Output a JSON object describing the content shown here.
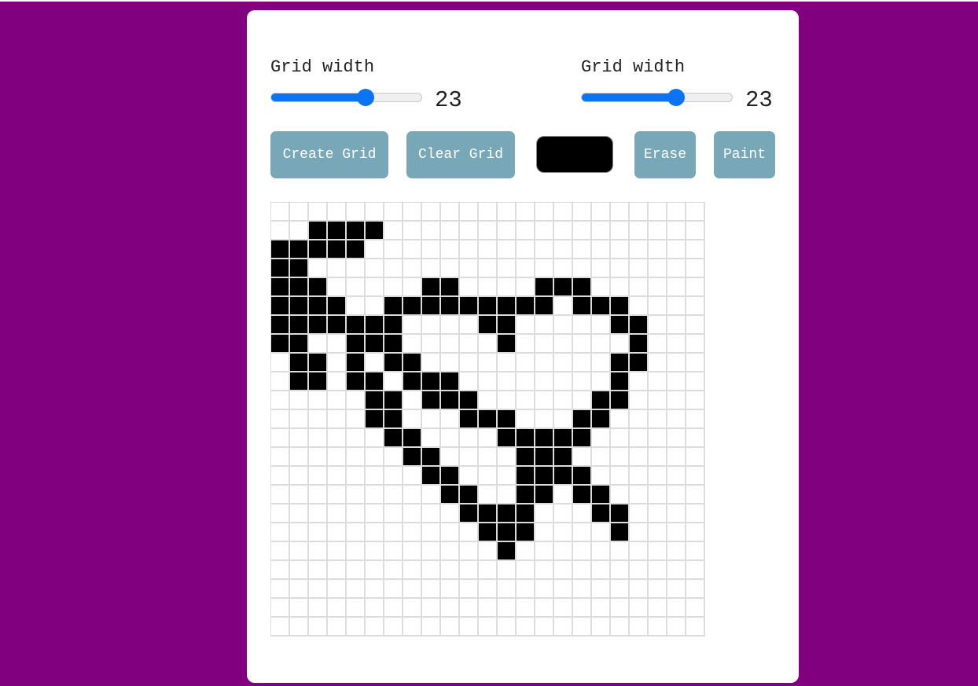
{
  "controls": {
    "width_slider": {
      "label": "Grid width",
      "value": 23,
      "min": 1,
      "max": 35
    },
    "height_slider": {
      "label": "Grid width",
      "value": 23,
      "min": 1,
      "max": 35
    }
  },
  "buttons": {
    "create": "Create Grid",
    "clear": "Clear Grid",
    "erase": "Erase",
    "paint": "Paint"
  },
  "colors": {
    "background": "#800080",
    "card": "#ffffff",
    "button": "#78a8b8",
    "slider_accent": "#0a74f5",
    "selected_paint": "#000000",
    "grid_line": "#dcdcdc"
  },
  "grid": {
    "columns": 23,
    "rows": 23,
    "filled_cells": [
      [
        1,
        2
      ],
      [
        1,
        3
      ],
      [
        1,
        4
      ],
      [
        1,
        5
      ],
      [
        2,
        0
      ],
      [
        2,
        1
      ],
      [
        2,
        2
      ],
      [
        2,
        3
      ],
      [
        2,
        4
      ],
      [
        3,
        0
      ],
      [
        3,
        1
      ],
      [
        4,
        0
      ],
      [
        4,
        1
      ],
      [
        4,
        2
      ],
      [
        4,
        8
      ],
      [
        4,
        9
      ],
      [
        4,
        14
      ],
      [
        4,
        15
      ],
      [
        4,
        16
      ],
      [
        5,
        0
      ],
      [
        5,
        1
      ],
      [
        5,
        2
      ],
      [
        5,
        3
      ],
      [
        5,
        6
      ],
      [
        5,
        7
      ],
      [
        5,
        8
      ],
      [
        5,
        9
      ],
      [
        5,
        10
      ],
      [
        5,
        11
      ],
      [
        5,
        12
      ],
      [
        5,
        13
      ],
      [
        5,
        14
      ],
      [
        5,
        16
      ],
      [
        5,
        17
      ],
      [
        5,
        18
      ],
      [
        6,
        0
      ],
      [
        6,
        1
      ],
      [
        6,
        2
      ],
      [
        6,
        3
      ],
      [
        6,
        4
      ],
      [
        6,
        5
      ],
      [
        6,
        6
      ],
      [
        6,
        11
      ],
      [
        6,
        12
      ],
      [
        6,
        18
      ],
      [
        6,
        19
      ],
      [
        7,
        0
      ],
      [
        7,
        1
      ],
      [
        7,
        4
      ],
      [
        7,
        5
      ],
      [
        7,
        6
      ],
      [
        7,
        12
      ],
      [
        7,
        19
      ],
      [
        8,
        1
      ],
      [
        8,
        2
      ],
      [
        8,
        4
      ],
      [
        8,
        6
      ],
      [
        8,
        7
      ],
      [
        8,
        18
      ],
      [
        8,
        19
      ],
      [
        9,
        1
      ],
      [
        9,
        2
      ],
      [
        9,
        4
      ],
      [
        9,
        5
      ],
      [
        9,
        7
      ],
      [
        9,
        8
      ],
      [
        9,
        9
      ],
      [
        9,
        18
      ],
      [
        10,
        5
      ],
      [
        10,
        6
      ],
      [
        10,
        8
      ],
      [
        10,
        9
      ],
      [
        10,
        10
      ],
      [
        10,
        17
      ],
      [
        10,
        18
      ],
      [
        11,
        5
      ],
      [
        11,
        6
      ],
      [
        11,
        10
      ],
      [
        11,
        11
      ],
      [
        11,
        12
      ],
      [
        11,
        16
      ],
      [
        11,
        17
      ],
      [
        12,
        6
      ],
      [
        12,
        7
      ],
      [
        12,
        12
      ],
      [
        12,
        13
      ],
      [
        12,
        14
      ],
      [
        12,
        15
      ],
      [
        12,
        16
      ],
      [
        13,
        7
      ],
      [
        13,
        8
      ],
      [
        13,
        13
      ],
      [
        13,
        14
      ],
      [
        13,
        15
      ],
      [
        14,
        8
      ],
      [
        14,
        9
      ],
      [
        14,
        13
      ],
      [
        14,
        14
      ],
      [
        14,
        15
      ],
      [
        14,
        16
      ],
      [
        15,
        9
      ],
      [
        15,
        10
      ],
      [
        15,
        13
      ],
      [
        15,
        14
      ],
      [
        15,
        16
      ],
      [
        15,
        17
      ],
      [
        16,
        10
      ],
      [
        16,
        11
      ],
      [
        16,
        12
      ],
      [
        16,
        13
      ],
      [
        16,
        17
      ],
      [
        16,
        18
      ],
      [
        17,
        11
      ],
      [
        17,
        12
      ],
      [
        17,
        13
      ],
      [
        17,
        18
      ],
      [
        18,
        12
      ]
    ]
  }
}
